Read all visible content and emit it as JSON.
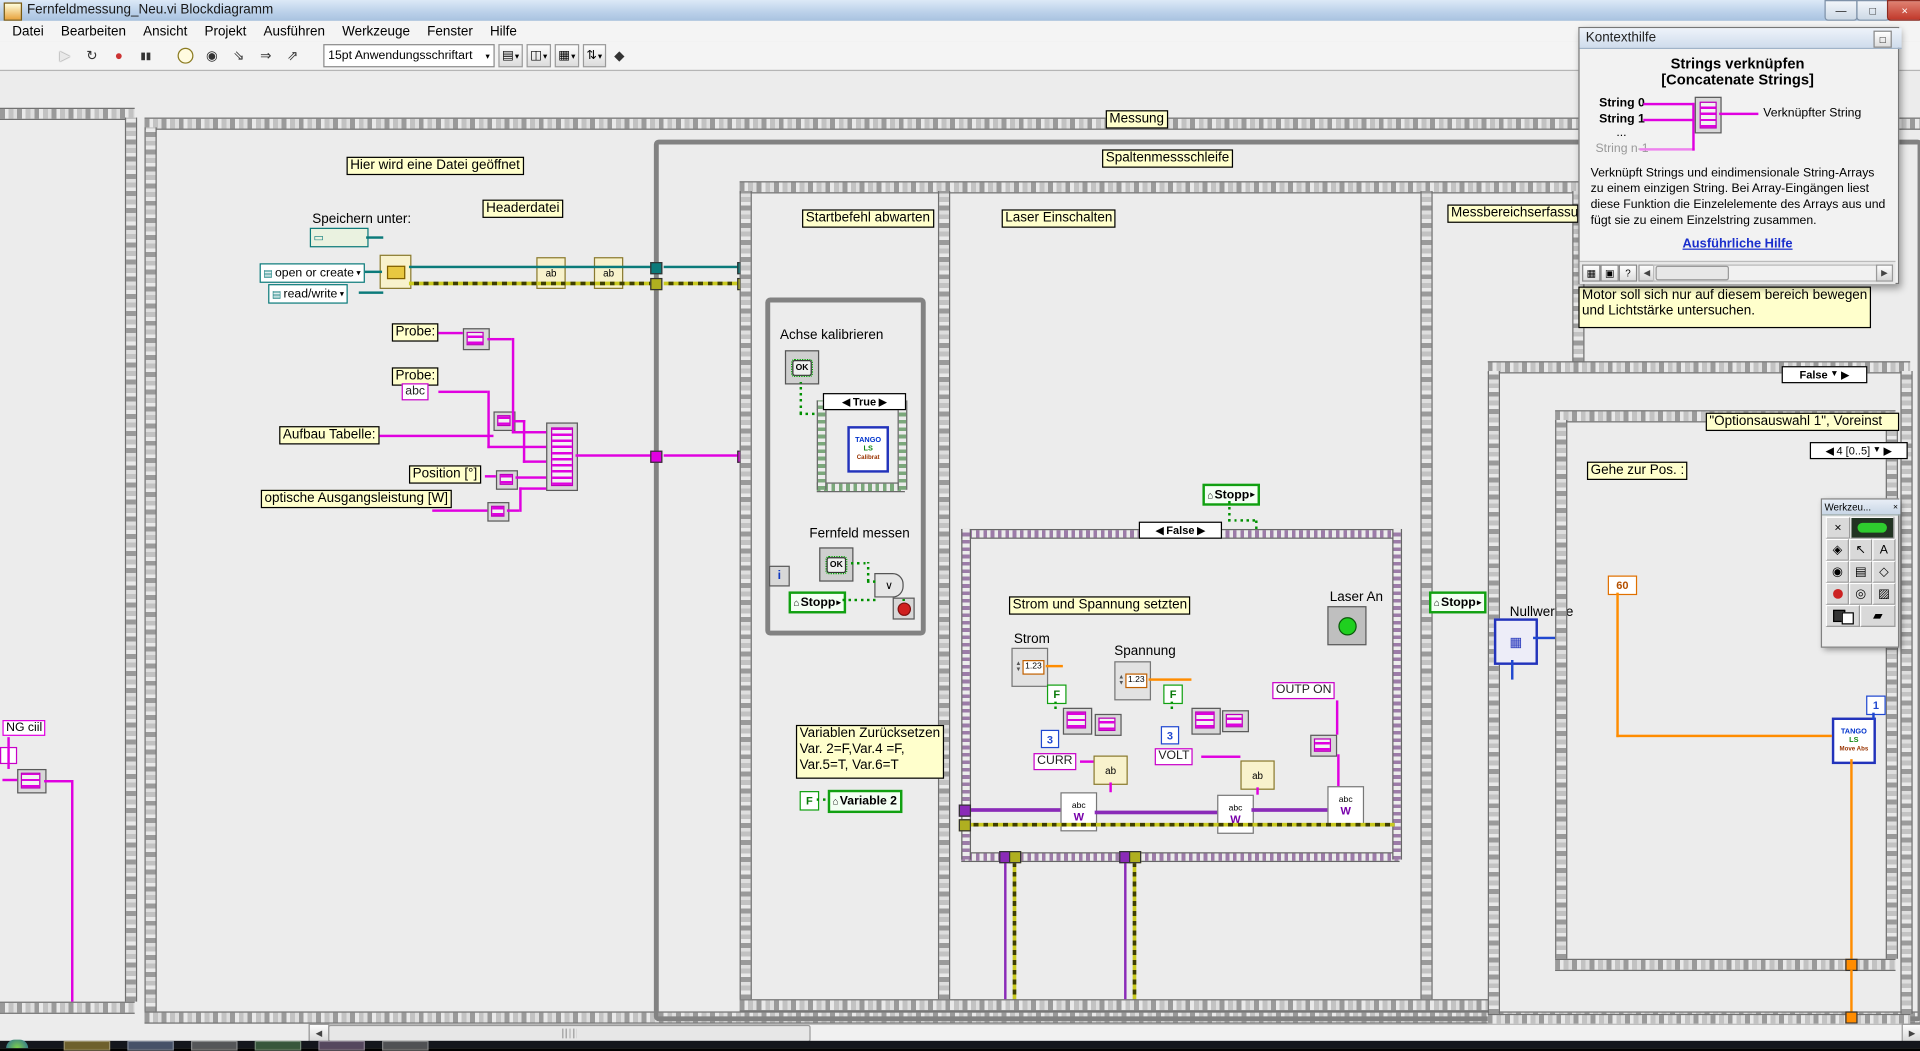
{
  "icons": {
    "min": "—",
    "max": "□",
    "close": "×",
    "run": "▶",
    "runcont": "↻",
    "abort": "●",
    "pause": "▮▮",
    "retain": "◉",
    "stepin": "⇘",
    "stepover": "⇒",
    "stepout": "⇗",
    "align": "▤",
    "distribute": "◫",
    "resize": "▦",
    "order": "⇅",
    "clean": "◆",
    "down": "▼",
    "downs": "▾",
    "left": "◀",
    "right": "▶",
    "rights": "▸",
    "home": "⌂",
    "enum": "▤",
    "path": "▭",
    "or": "∨",
    "grid": "▦",
    "lock": "▣",
    "qmark": "?",
    "tool_auto": "×",
    "tool_operate": "◈",
    "tool_position": "↖",
    "tool_text": "A",
    "tool_wire": "◉",
    "tool_menu": "▤",
    "tool_scroll": "◇",
    "tool_probe": "◎",
    "tool_color": "▨",
    "tool_brush": "▰"
  },
  "window": {
    "title": "Fernfeldmessung_Neu.vi Blockdiagramm",
    "menu": [
      "Datei",
      "Bearbeiten",
      "Ansicht",
      "Projekt",
      "Ausführen",
      "Werkzeuge",
      "Fenster",
      "Hilfe"
    ],
    "font_selector": "15pt Anwendungsschriftart"
  },
  "help": {
    "title": "Kontexthilfe",
    "heading": "Strings verknüpfen",
    "subheading": "[Concatenate Strings]",
    "in0": "String 0",
    "in1": "String 1",
    "dots": "...",
    "inN": "String n-1",
    "output": "Verknüpfter String",
    "description": "Verknüpft Strings und eindimensionale String-Arrays zu einem einzigen String. Bei Array-Eingängen liest diese Funktion die Einzelelemente des Arrays aus und fügt sie zu einem Einzelstring zusammen.",
    "link": "Ausführliche Hilfe"
  },
  "tools": {
    "title": "Werkzeu..."
  },
  "d": {
    "messung": "Messung",
    "spalten": "Spaltenmessschleife",
    "file_comment": "Hier wird eine Datei geöffnet",
    "headerdatei": "Headerdatei",
    "speichern": "Speichern unter:",
    "open_or_create": "open or create",
    "read_write": "read/write",
    "probe": "Probe:",
    "abc": "abc",
    "aufbau": "Aufbau Tabelle:",
    "position": "Position [°]",
    "optische": "optische Ausgangsleistung [W]",
    "frame1": "Startbefehl abwarten",
    "achse": "Achse kalibrieren",
    "true": "True",
    "fernfeld": "Fernfeld messen",
    "stopp": "Stopp",
    "i": "i",
    "ok": "OK",
    "var1": "Variablen Zurücksetzen",
    "var2": "Var. 2=F,Var.4 =F,",
    "var3": "Var.5=T, Var.6=T",
    "f": "F",
    "variable2": "Variable 2",
    "frame2": "Laser Einschalten",
    "false": "False",
    "strom_spannung": "Strom und Spannung setzten",
    "strom": "Strom",
    "spannung": "Spannung",
    "laser_an": "Laser An",
    "outp_on": "OUTP ON",
    "three": "3",
    "curr": "CURR",
    "volt": "VOLT",
    "ab": "ab",
    "abcw": "abc",
    "w": "W",
    "num": "1.23",
    "frame3": "Messbereichserfassung",
    "nullwert": "Nullwertbes",
    "options": "\"Optionsauswahl 1\", Voreinst",
    "seqsel": "4 [0..5]",
    "gehe": "Gehe zur Pos. :",
    "c60": "60",
    "c1": "1",
    "motor1": "Motor soll sich  nur auf diesem bereich bewegen",
    "motor2": "und Lichtstärke untersuchen.",
    "ng": "NG ciil",
    "tango": "TANGO",
    "ls": "LS",
    "calibrat": "Calibrat",
    "move": "Move Abs"
  }
}
